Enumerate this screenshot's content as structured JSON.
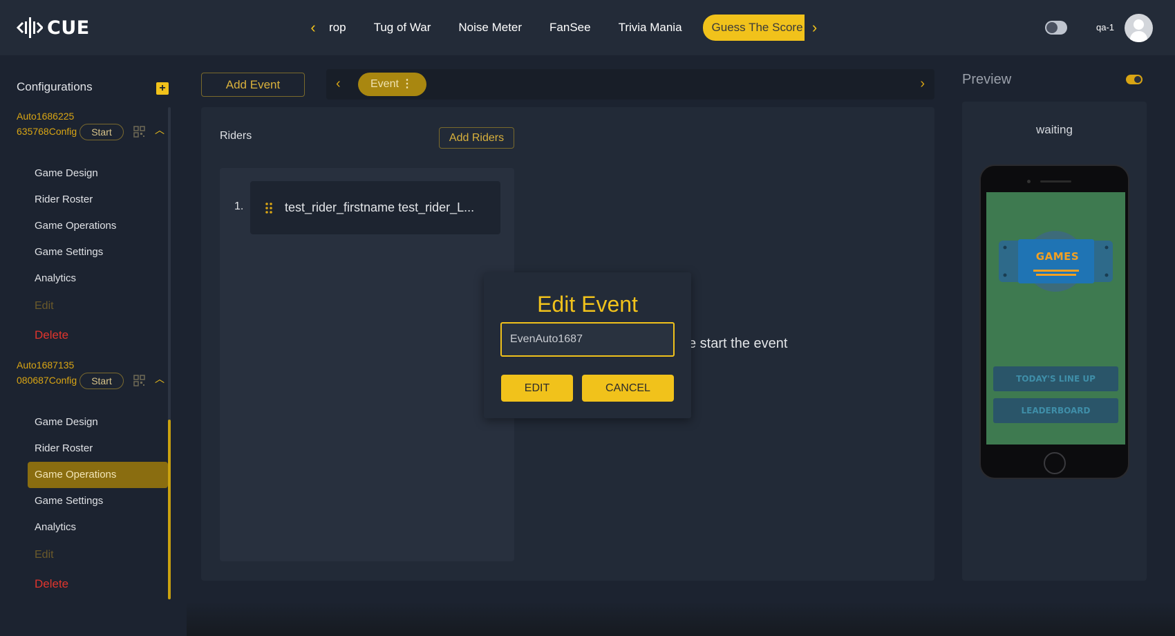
{
  "app": {
    "logo_text": "CUE"
  },
  "nav": {
    "tabs": [
      {
        "label": "rop"
      },
      {
        "label": "Tug of War"
      },
      {
        "label": "Noise Meter"
      },
      {
        "label": "FanSee"
      },
      {
        "label": "Trivia Mania"
      },
      {
        "label": "Guess The Score",
        "active": true
      }
    ]
  },
  "user": {
    "name": "qa-1"
  },
  "sidebar": {
    "title": "Configurations",
    "configs": [
      {
        "name": "Auto1686225635768Config",
        "start_label": "Start",
        "items": [
          "Game Design",
          "Rider Roster",
          "Game Operations",
          "Game Settings",
          "Analytics",
          "Edit",
          "Delete"
        ]
      },
      {
        "name": "Auto1687135080687Config",
        "start_label": "Start",
        "active_item": "Game Operations",
        "items": [
          "Game Design",
          "Rider Roster",
          "Game Operations",
          "Game Settings",
          "Analytics",
          "Edit",
          "Delete"
        ]
      }
    ]
  },
  "toolbar": {
    "add_event_label": "Add Event",
    "event_chip_label": "Event"
  },
  "riders": {
    "label": "Riders",
    "add_label": "Add Riders",
    "items": [
      {
        "index": "1.",
        "name": "test_rider_firstname test_rider_L..."
      }
    ]
  },
  "hint_text": "e start the event",
  "preview": {
    "title": "Preview",
    "status": "waiting",
    "screen": {
      "logo_text": "GAMES",
      "buttons": [
        "TODAY'S LINE UP",
        "LEADERBOARD"
      ]
    }
  },
  "modal": {
    "title": "Edit Event",
    "input_value": "EvenAuto1687",
    "edit_label": "EDIT",
    "cancel_label": "CANCEL"
  },
  "colors": {
    "accent": "#f1c21b",
    "danger": "#e0352d",
    "background": "#1c2330"
  }
}
